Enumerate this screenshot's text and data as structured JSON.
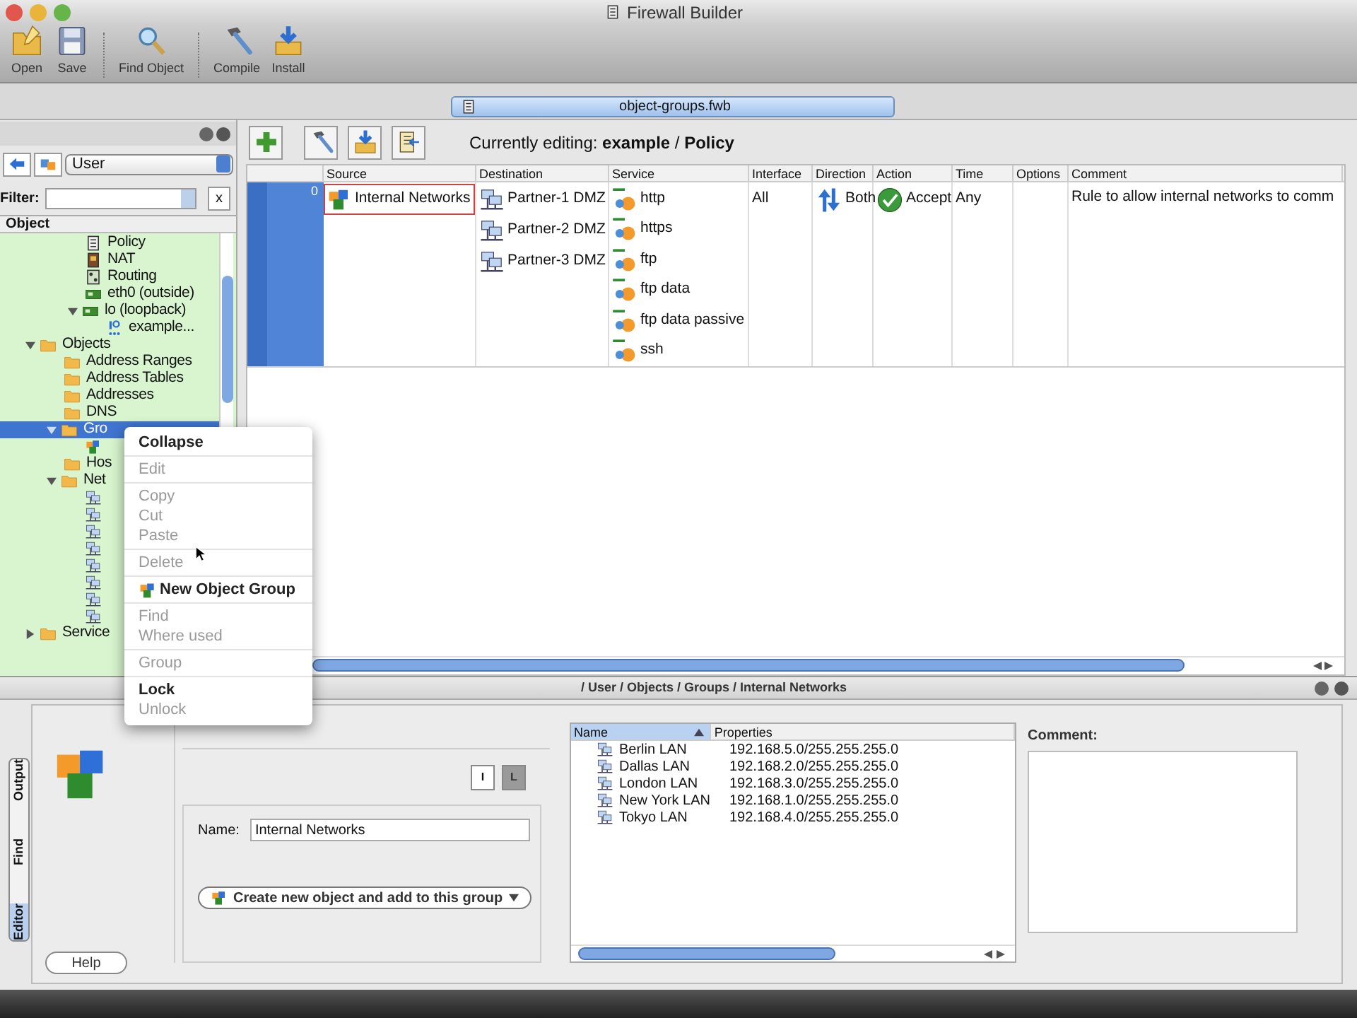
{
  "window": {
    "title": "Firewall Builder"
  },
  "toolbar": [
    {
      "label": "Open",
      "kind": "open"
    },
    {
      "label": "Save",
      "kind": "save"
    },
    {
      "label": "Find Object",
      "kind": "find"
    },
    {
      "label": "Compile",
      "kind": "compile"
    },
    {
      "label": "Install",
      "kind": "install"
    }
  ],
  "file_tab": {
    "label": "object-groups.fwb"
  },
  "object_tree": {
    "library": "User",
    "filter_label": "Filter:",
    "clear_button": "x",
    "column": "Object",
    "scrolled_branch": [
      {
        "label": "Policy",
        "kind": "policy",
        "selected": false
      },
      {
        "label": "NAT",
        "kind": "nat",
        "selected": false
      },
      {
        "label": "Routing",
        "kind": "routing",
        "selected": false
      },
      {
        "label": "eth0 (outside)",
        "kind": "interface",
        "selected": false
      },
      {
        "label": "lo (loopback)",
        "kind": "interface",
        "selected": false,
        "expanded": true,
        "children": [
          {
            "label": "example...",
            "kind": "address",
            "selected": false
          }
        ]
      }
    ],
    "items": [
      {
        "label": "Objects",
        "kind": "folder",
        "selected": false,
        "expanded": true,
        "children": [
          {
            "label": "Address Ranges",
            "kind": "folder",
            "selected": false
          },
          {
            "label": "Address Tables",
            "kind": "folder",
            "selected": false
          },
          {
            "label": "Addresses",
            "kind": "folder",
            "selected": false
          },
          {
            "label": "DNS",
            "kind": "folder",
            "selected": false
          },
          {
            "label": "Gro",
            "kind": "folder",
            "selected": true,
            "expanded": true,
            "children": [
              {
                "kind": "group",
                "selected": false
              }
            ]
          },
          {
            "label": "Hos",
            "kind": "folder",
            "selected": false
          },
          {
            "label": "Net",
            "kind": "folder",
            "selected": false,
            "expanded": true,
            "children": [
              {
                "kind": "network",
                "selected": false
              },
              {
                "kind": "network",
                "selected": false
              },
              {
                "kind": "network",
                "selected": false
              },
              {
                "kind": "network",
                "selected": false
              },
              {
                "kind": "network",
                "selected": false
              },
              {
                "kind": "network",
                "selected": false
              },
              {
                "kind": "network",
                "selected": false
              },
              {
                "kind": "network",
                "selected": false
              }
            ]
          }
        ]
      },
      {
        "label": "Service",
        "kind": "folder",
        "selected": false,
        "expanded": false
      }
    ]
  },
  "policy": {
    "editing": "Currently editing: **example** / **Policy**",
    "columns": [
      "Source",
      "Destination",
      "Service",
      "Interface",
      "Direction",
      "Action",
      "Time",
      "Options",
      "Comment"
    ],
    "rules": [
      {
        "number": "0",
        "source": [
          {
            "label": "Internal Networks",
            "kind": "group",
            "selected": true
          }
        ],
        "destination": [
          {
            "label": "Partner-1 DMZ",
            "kind": "network",
            "selected": false
          },
          {
            "label": "Partner-2 DMZ",
            "kind": "network",
            "selected": false
          },
          {
            "label": "Partner-3 DMZ",
            "kind": "network",
            "selected": false
          }
        ],
        "service": [
          {
            "label": "http",
            "kind": "tcp",
            "selected": false
          },
          {
            "label": "https",
            "kind": "tcp",
            "selected": false
          },
          {
            "label": "ftp",
            "kind": "tcp",
            "selected": false
          },
          {
            "label": "ftp data",
            "kind": "tcp",
            "selected": false
          },
          {
            "label": "ftp data passive",
            "kind": "tcp",
            "selected": false
          },
          {
            "label": "ssh",
            "kind": "tcp",
            "selected": false
          }
        ],
        "interface": "All",
        "direction": "Both",
        "action": "Accept",
        "time": "Any",
        "comment": "Rule to allow internal networks to comm"
      }
    ]
  },
  "context_menu": [
    [
      {
        "label": "Collapse",
        "disabled": false,
        "kind": "plain"
      }
    ],
    [
      {
        "label": "Edit",
        "disabled": true,
        "kind": "plain"
      }
    ],
    [
      {
        "label": "Copy",
        "disabled": true,
        "kind": "plain"
      },
      {
        "label": "Cut",
        "disabled": true,
        "kind": "plain"
      },
      {
        "label": "Paste",
        "disabled": true,
        "kind": "plain"
      }
    ],
    [
      {
        "label": "Delete",
        "disabled": true,
        "kind": "plain"
      }
    ],
    [
      {
        "label": "New Object Group",
        "disabled": false,
        "kind": "group"
      }
    ],
    [
      {
        "label": "Find",
        "disabled": true,
        "kind": "plain"
      },
      {
        "label": "Where used",
        "disabled": true,
        "kind": "plain"
      }
    ],
    [
      {
        "label": "Group",
        "disabled": true,
        "kind": "plain"
      }
    ],
    [
      {
        "label": "Lock",
        "disabled": false,
        "kind": "plain"
      },
      {
        "label": "Unlock",
        "disabled": true,
        "kind": "plain"
      }
    ]
  ],
  "editor": {
    "path": "/ User / Objects / Groups / Internal Networks",
    "side_tabs": [
      {
        "label": "Output",
        "selected": false
      },
      {
        "label": "Find",
        "selected": false
      },
      {
        "label": "Editor",
        "selected": true
      }
    ],
    "view_buttons": [
      {
        "label": "I",
        "selected": false
      },
      {
        "label": "L",
        "selected": true
      }
    ],
    "name_label": "Name:",
    "name_value": "Internal Networks",
    "create_button": "Create new object and add to this group",
    "members": {
      "columns": [
        {
          "label": "Name",
          "selected": true
        },
        {
          "label": "Properties",
          "selected": false
        }
      ],
      "rows": [
        {
          "name": "Berlin LAN",
          "properties": "192.168.5.0/255.255.255.0"
        },
        {
          "name": "Dallas LAN",
          "properties": "192.168.2.0/255.255.255.0"
        },
        {
          "name": "London LAN",
          "properties": "192.168.3.0/255.255.255.0"
        },
        {
          "name": "New York LAN",
          "properties": "192.168.1.0/255.255.255.0"
        },
        {
          "name": "Tokyo LAN",
          "properties": "192.168.4.0/255.255.255.0"
        }
      ]
    },
    "comment_label": "Comment:",
    "help": "Help"
  }
}
